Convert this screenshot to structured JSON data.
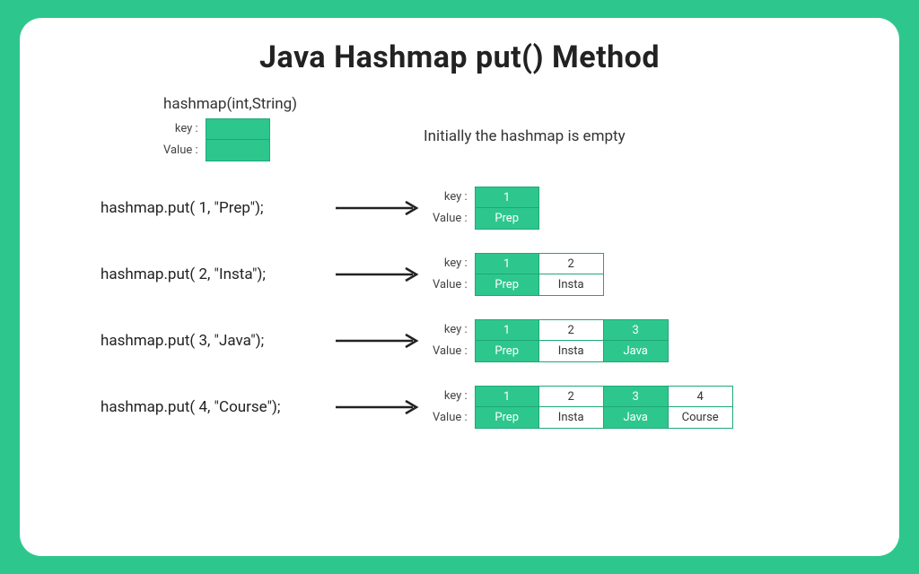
{
  "title": "Java Hashmap put() Method",
  "declaration": {
    "signature": "hashmap(int,String)",
    "note": "Initially the hashmap is empty",
    "keyLabel": "key :",
    "valueLabel": "Value :"
  },
  "labels": {
    "key": "key :",
    "value": "Value :"
  },
  "steps": [
    {
      "code": "hashmap.put( 1, \"Prep\");",
      "entries": [
        {
          "key": "1",
          "value": "Prep",
          "filled": true
        }
      ]
    },
    {
      "code": "hashmap.put( 2, \"Insta\");",
      "entries": [
        {
          "key": "1",
          "value": "Prep",
          "filled": true
        },
        {
          "key": "2",
          "value": "Insta",
          "filled": false
        }
      ]
    },
    {
      "code": "hashmap.put( 3, \"Java\");",
      "entries": [
        {
          "key": "1",
          "value": "Prep",
          "filled": true
        },
        {
          "key": "2",
          "value": "Insta",
          "filled": false
        },
        {
          "key": "3",
          "value": "Java",
          "filled": true
        }
      ]
    },
    {
      "code": "hashmap.put( 4, \"Course\");",
      "entries": [
        {
          "key": "1",
          "value": "Prep",
          "filled": true
        },
        {
          "key": "2",
          "value": "Insta",
          "filled": false
        },
        {
          "key": "3",
          "value": "Java",
          "filled": true
        },
        {
          "key": "4",
          "value": "Course",
          "filled": false
        }
      ]
    }
  ]
}
